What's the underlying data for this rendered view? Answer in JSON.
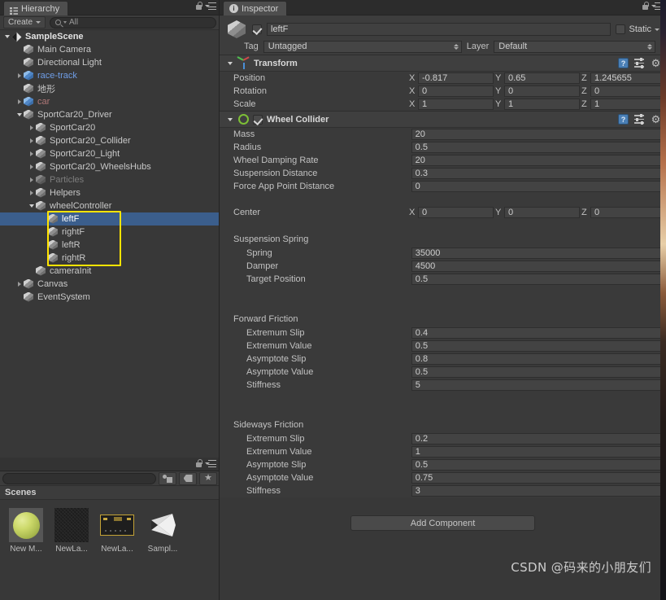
{
  "hierarchy": {
    "tab_label": "Hierarchy",
    "create_label": "Create",
    "search_value": "All",
    "items": [
      {
        "label": "SampleScene",
        "depth": 0,
        "arrow": "down",
        "icon": "unity-scene-icon",
        "style": "scene"
      },
      {
        "label": "Main Camera",
        "depth": 1,
        "arrow": "none",
        "icon": "gameobject-cube-icon",
        "style": "normal"
      },
      {
        "label": "Directional Light",
        "depth": 1,
        "arrow": "none",
        "icon": "gameobject-cube-icon",
        "style": "normal"
      },
      {
        "label": "race-track",
        "depth": 1,
        "arrow": "right",
        "icon": "prefab-cube-icon",
        "style": "prefab"
      },
      {
        "label": "地形",
        "depth": 1,
        "arrow": "none",
        "icon": "gameobject-cube-icon",
        "style": "normal"
      },
      {
        "label": "car",
        "depth": 1,
        "arrow": "right",
        "icon": "prefab-cube-icon",
        "style": "prefab-red"
      },
      {
        "label": "SportCar20_Driver",
        "depth": 1,
        "arrow": "down",
        "icon": "gameobject-cube-icon",
        "style": "normal"
      },
      {
        "label": "SportCar20",
        "depth": 2,
        "arrow": "right",
        "icon": "gameobject-cube-icon",
        "style": "normal"
      },
      {
        "label": "SportCar20_Collider",
        "depth": 2,
        "arrow": "right",
        "icon": "gameobject-cube-icon",
        "style": "normal"
      },
      {
        "label": "SportCar20_Light",
        "depth": 2,
        "arrow": "right",
        "icon": "gameobject-cube-icon",
        "style": "normal"
      },
      {
        "label": "SportCar20_WheelsHubs",
        "depth": 2,
        "arrow": "right",
        "icon": "gameobject-cube-icon",
        "style": "normal"
      },
      {
        "label": "Particles",
        "depth": 2,
        "arrow": "right",
        "icon": "gameobject-cube-icon",
        "style": "inactive"
      },
      {
        "label": "Helpers",
        "depth": 2,
        "arrow": "right",
        "icon": "gameobject-cube-icon",
        "style": "normal"
      },
      {
        "label": "wheelController",
        "depth": 2,
        "arrow": "down",
        "icon": "gameobject-cube-icon",
        "style": "normal"
      },
      {
        "label": "leftF",
        "depth": 3,
        "arrow": "none",
        "icon": "gameobject-cube-icon",
        "style": "selected"
      },
      {
        "label": "rightF",
        "depth": 3,
        "arrow": "none",
        "icon": "gameobject-cube-icon",
        "style": "normal"
      },
      {
        "label": "leftR",
        "depth": 3,
        "arrow": "none",
        "icon": "gameobject-cube-icon",
        "style": "normal"
      },
      {
        "label": "rightR",
        "depth": 3,
        "arrow": "none",
        "icon": "gameobject-cube-icon",
        "style": "normal"
      },
      {
        "label": "cameraInit",
        "depth": 2,
        "arrow": "none",
        "icon": "gameobject-cube-icon",
        "style": "normal"
      },
      {
        "label": "Canvas",
        "depth": 1,
        "arrow": "right",
        "icon": "gameobject-cube-icon",
        "style": "normal"
      },
      {
        "label": "EventSystem",
        "depth": 1,
        "arrow": "none",
        "icon": "gameobject-cube-icon",
        "style": "normal"
      }
    ]
  },
  "project": {
    "search_value": "",
    "breadcrumb": "Scenes",
    "assets": [
      {
        "label": "New M...",
        "thumb": "material-sphere-icon"
      },
      {
        "label": "NewLa...",
        "thumb": "lightmap-noise-icon"
      },
      {
        "label": "NewLa...",
        "thumb": "lightmap-board-icon"
      },
      {
        "label": "Sampl...",
        "thumb": "unity-scene-icon"
      }
    ]
  },
  "inspector": {
    "tab_label": "Inspector",
    "object_name": "leftF",
    "object_enabled": true,
    "static_label": "Static",
    "static_checked": false,
    "tag_label": "Tag",
    "tag_value": "Untagged",
    "layer_label": "Layer",
    "layer_value": "Default",
    "components": [
      {
        "name": "Transform",
        "icon": "transform-axis-icon",
        "has_checkbox": false,
        "rows": [
          {
            "kind": "vector3",
            "label": "Position",
            "x": "-0.817",
            "y": "0.65",
            "z": "1.245655"
          },
          {
            "kind": "vector3",
            "label": "Rotation",
            "x": "0",
            "y": "0",
            "z": "0"
          },
          {
            "kind": "vector3",
            "label": "Scale",
            "x": "1",
            "y": "1",
            "z": "1"
          }
        ]
      },
      {
        "name": "Wheel Collider",
        "icon": "wheel-collider-icon",
        "has_checkbox": true,
        "checked": true,
        "rows": [
          {
            "kind": "field",
            "label": "Mass",
            "value": "20"
          },
          {
            "kind": "field",
            "label": "Radius",
            "value": "0.5"
          },
          {
            "kind": "field",
            "label": "Wheel Damping Rate",
            "value": "20"
          },
          {
            "kind": "field",
            "label": "Suspension Distance",
            "value": "0.3"
          },
          {
            "kind": "field",
            "label": "Force App Point Distance",
            "value": "0"
          },
          {
            "kind": "spacer"
          },
          {
            "kind": "vector3",
            "label": "Center",
            "x": "0",
            "y": "0",
            "z": "0"
          },
          {
            "kind": "spacer"
          },
          {
            "kind": "header",
            "label": "Suspension Spring"
          },
          {
            "kind": "field2",
            "label": "Spring",
            "value": "35000"
          },
          {
            "kind": "field2",
            "label": "Damper",
            "value": "4500"
          },
          {
            "kind": "field2",
            "label": "Target Position",
            "value": "0.5"
          },
          {
            "kind": "spacer"
          },
          {
            "kind": "spacer"
          },
          {
            "kind": "header",
            "label": "Forward Friction"
          },
          {
            "kind": "field2",
            "label": "Extremum Slip",
            "value": "0.4"
          },
          {
            "kind": "field2",
            "label": "Extremum Value",
            "value": "0.5"
          },
          {
            "kind": "field2",
            "label": "Asymptote Slip",
            "value": "0.8"
          },
          {
            "kind": "field2",
            "label": "Asymptote Value",
            "value": "0.5"
          },
          {
            "kind": "field2",
            "label": "Stiffness",
            "value": "5"
          },
          {
            "kind": "spacer"
          },
          {
            "kind": "spacer"
          },
          {
            "kind": "header",
            "label": "Sideways Friction"
          },
          {
            "kind": "field2",
            "label": "Extremum Slip",
            "value": "0.2"
          },
          {
            "kind": "field2",
            "label": "Extremum Value",
            "value": "1"
          },
          {
            "kind": "field2",
            "label": "Asymptote Slip",
            "value": "0.5"
          },
          {
            "kind": "field2",
            "label": "Asymptote Value",
            "value": "0.75"
          },
          {
            "kind": "field2",
            "label": "Stiffness",
            "value": "3"
          }
        ]
      }
    ],
    "add_component_label": "Add Component"
  },
  "watermark": "CSDN @码来的小朋友们",
  "colors": {
    "selection_blue": "#3b5e8c",
    "annotation_yellow": "#ffe400",
    "panel_bg": "#383838",
    "prefab_blue": "#6f9ee8",
    "wheel_green": "#7dbf36"
  }
}
